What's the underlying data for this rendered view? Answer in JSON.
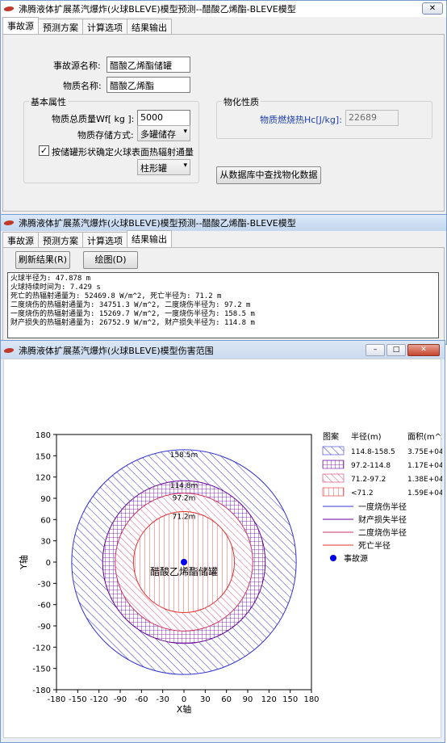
{
  "window1": {
    "title": "沸腾液体扩展蒸汽爆炸(火球BLEVE)模型预测--醋酸乙烯酯-BLEVE模型",
    "close_glyph": "✕",
    "tabs": [
      "事故源",
      "预测方案",
      "计算选项",
      "结果输出"
    ],
    "source_name_label": "事故源名称:",
    "source_name_value": "醋酸乙烯酯储罐",
    "material_label": "物质名称:",
    "material_value": "醋酸乙烯酯",
    "basic_group": "基本属性",
    "mass_label": "物质总质量Wf[ kg ]:",
    "mass_value": "5000",
    "storage_label": "物质存储方式:",
    "storage_value": "多罐储存",
    "checkbox_label": "按储罐形状确定火球表面热辐射通量",
    "checkbox_checked": true,
    "shape_value": "柱形罐",
    "physchem_group": "物化性质",
    "heat_label": "物质燃烧热Hc[J/kg]:",
    "heat_value": "22689",
    "db_button": "从数据库中查找物化数据"
  },
  "window2": {
    "title": "沸腾液体扩展蒸汽爆炸(火球BLEVE)模型预测--醋酸乙烯酯-BLEVE模型",
    "tabs": [
      "事故源",
      "预测方案",
      "计算选项",
      "结果输出"
    ],
    "refresh_button": "刷新结果(R)",
    "plot_button": "绘图(D)",
    "results": [
      "火球半径为: 47.878 m",
      "火球持续时间为: 7.429 s",
      "死亡的热辐射通量为: 52469.8 W/m^2, 死亡半径为: 71.2 m",
      "二度烧伤的热辐射通量为: 34751.3 W/m^2, 二度烧伤半径为: 97.2 m",
      "一度烧伤的热辐射通量为: 15269.7 W/m^2, 一度烧伤半径为: 158.5 m",
      "财产损失的热辐射通量为: 26752.9 W/m^2, 财产损失半径为: 114.8 m"
    ]
  },
  "window3": {
    "title": "沸腾液体扩展蒸汽爆炸(火球BLEVE)模型伤害范围",
    "min_glyph": "–",
    "max_glyph": "□",
    "close_glyph": "✕"
  },
  "chart_data": {
    "type": "scatter",
    "xlabel": "X轴",
    "ylabel": "Y轴",
    "xlim": [
      -180,
      180
    ],
    "ylim": [
      -180,
      180
    ],
    "xticks": [
      -180,
      -150,
      -120,
      -90,
      -60,
      -30,
      0,
      30,
      60,
      90,
      120,
      150,
      180
    ],
    "yticks": [
      180,
      150,
      120,
      90,
      60,
      30,
      0,
      -30,
      -60,
      -90,
      -120,
      -150,
      -180
    ],
    "center": [
      0,
      0
    ],
    "source_label": "醋酸乙烯酯储罐",
    "circles": [
      {
        "name": "一度烧伤半径",
        "radius": 158.5,
        "label": "158.5m",
        "color": "#3333cc"
      },
      {
        "name": "财产损失半径",
        "radius": 114.8,
        "label": "114.8m",
        "color": "#660099"
      },
      {
        "name": "二度烧伤半径",
        "radius": 97.2,
        "label": "97.2m",
        "color": "#cc3366"
      },
      {
        "name": "死亡半径",
        "radius": 71.2,
        "label": "71.2m",
        "color": "#e03030"
      }
    ],
    "legend": {
      "headers": [
        "图案",
        "半径(m)",
        "面积(m^2)"
      ],
      "bands": [
        {
          "range": "114.8-158.5",
          "area": "3.75E+04",
          "pattern": "diag",
          "color": "#3333cc"
        },
        {
          "range": "97.2-114.8",
          "area": "1.17E+04",
          "pattern": "grid",
          "color": "#660099"
        },
        {
          "range": "71.2-97.2",
          "area": "1.38E+04",
          "pattern": "diag",
          "color": "#cc3366"
        },
        {
          "range": "<71.2",
          "area": "1.59E+04",
          "pattern": "vert",
          "color": "#e03030"
        }
      ],
      "lines": [
        {
          "label": "一度烧伤半径",
          "color": "#3333cc"
        },
        {
          "label": "财产损失半径",
          "color": "#660099"
        },
        {
          "label": "二度烧伤半径",
          "color": "#cc3366"
        },
        {
          "label": "死亡半径",
          "color": "#e03030"
        }
      ],
      "marker_label": "事故源",
      "marker_color": "#0000ee"
    }
  }
}
